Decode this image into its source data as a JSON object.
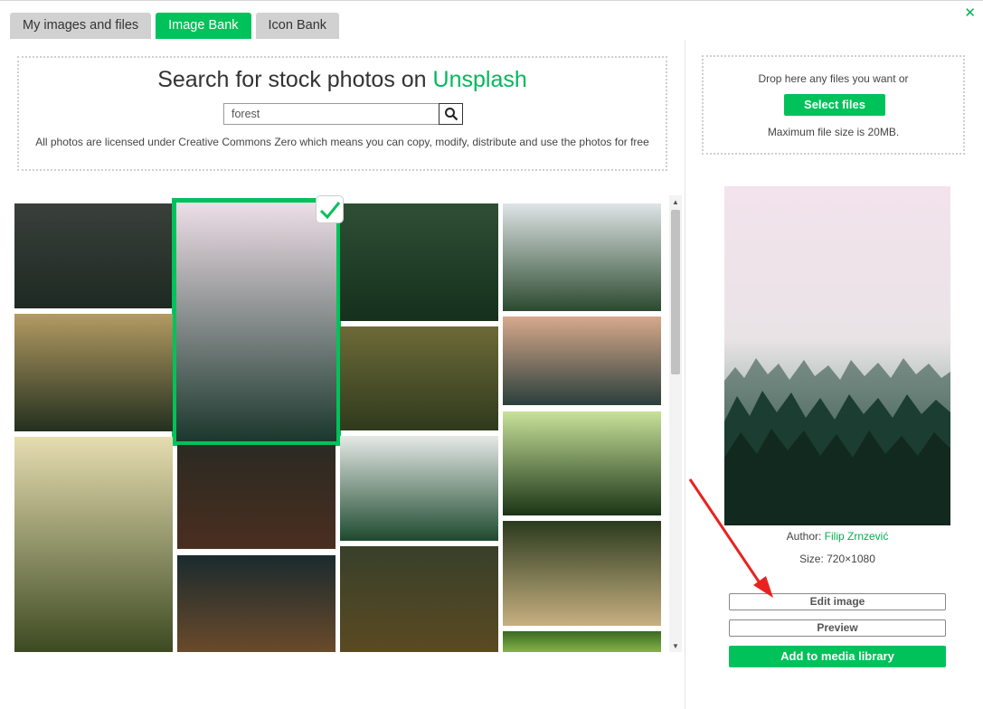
{
  "tabs": [
    {
      "label": "My images and files",
      "active": false
    },
    {
      "label": "Image Bank",
      "active": true
    },
    {
      "label": "Icon Bank",
      "active": false
    }
  ],
  "close_icon": "close-icon",
  "search": {
    "title_prefix": "Search for stock photos on ",
    "title_brand": "Unsplash",
    "query": "forest",
    "license_text": "All photos are licensed under Creative Commons Zero which means you can copy, modify, distribute and use the photos for free"
  },
  "results": {
    "selected_index": 1,
    "thumbnails": [
      {
        "desc": "misty forest",
        "colors": [
          "#3a3f3a",
          "#1d2a22"
        ]
      },
      {
        "desc": "foggy pine forest (selected)",
        "colors": [
          "#f1e1ea",
          "#18352a"
        ]
      },
      {
        "desc": "aerial forest road",
        "colors": [
          "#2f4f35",
          "#15301d"
        ]
      },
      {
        "desc": "lake in mountains",
        "colors": [
          "#dfe4e6",
          "#2b4a2f"
        ]
      },
      {
        "desc": "sunlit forest",
        "colors": [
          "#b39a62",
          "#23301f"
        ]
      },
      {
        "desc": "forest path",
        "colors": [
          "#6d6a38",
          "#2f3a1c"
        ]
      },
      {
        "desc": "mountain sunset",
        "colors": [
          "#d8a98c",
          "#2b3f3b"
        ]
      },
      {
        "desc": "sunbeams in trees",
        "colors": [
          "#e6ddb0",
          "#3d4a22"
        ]
      },
      {
        "desc": "redwood forest",
        "colors": [
          "#2b2a22",
          "#4a2e20"
        ]
      },
      {
        "desc": "misty valley",
        "colors": [
          "#e5e9e6",
          "#1e4a2f"
        ]
      },
      {
        "desc": "canopy from below",
        "colors": [
          "#c8e29a",
          "#1b3416"
        ]
      },
      {
        "desc": "forest trail",
        "colors": [
          "#1b2a2e",
          "#6a4a2a"
        ]
      },
      {
        "desc": "autumn forest",
        "colors": [
          "#38402a",
          "#5a4a22"
        ]
      },
      {
        "desc": "road with sun",
        "colors": [
          "#2b3a1e",
          "#c7b080"
        ]
      },
      {
        "desc": "green leaves",
        "colors": [
          "#3a6a22",
          "#86b24a"
        ]
      }
    ]
  },
  "upload": {
    "drop_text": "Drop here any files you want or",
    "select_label": "Select files",
    "max_size_text": "Maximum file size is 20MB."
  },
  "preview": {
    "author_label": "Author: ",
    "author_name": "Filip Zrnzević",
    "size_text": "Size: 720×1080",
    "edit_label": "Edit image",
    "preview_label": "Preview",
    "add_label": "Add to media library"
  },
  "colors": {
    "accent": "#00c25a",
    "annotation_arrow": "#e8231f"
  }
}
